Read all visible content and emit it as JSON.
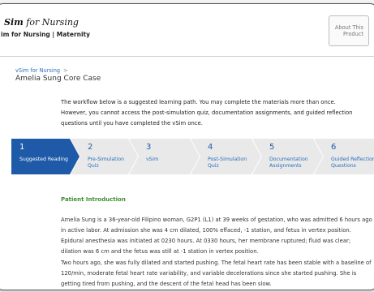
{
  "header": {
    "brand_bold": "Sim",
    "brand_rest": " for Nursing",
    "subtitle": "im for Nursing | Maternity",
    "about_label": "About This Product"
  },
  "breadcrumb": {
    "link": "vSim for Nursing",
    "separator": ">",
    "case_title": "Amelia Sung Core Case"
  },
  "intro": {
    "line1": "The workflow below is a suggested learning path. You may complete the materials more than once.",
    "line2": "However, you cannot access the post-simulation quiz, documentation assignments, and guided reflection",
    "line3": "questions until you have completed the vSim once."
  },
  "steps": [
    {
      "num": "1",
      "label": "Suggested Reading"
    },
    {
      "num": "2",
      "label": "Pre-Simulation Quiz"
    },
    {
      "num": "3",
      "label": "vSim"
    },
    {
      "num": "4",
      "label": "Post-Simulation Quiz"
    },
    {
      "num": "5",
      "label": "Documentation Assignments"
    },
    {
      "num": "6",
      "label": "Guided Reflection Questions"
    }
  ],
  "content": {
    "section_heading": "Patient Introduction",
    "paragraph1": "Amelia Sung is a 36-year-old Filipino woman, G2P1 (L1) at 39 weeks of gestation, who was admitted 6 hours ago in active labor. At admission she was 4 cm dilated, 100% effaced, -1 station, and fetus in vertex position. Epidural anesthesia was initiated at 0230 hours. At 0330 hours, her membrane ruptured; fluid was clear; dilation was 6 cm and the fetus was still at -1 station in vertex position.",
    "paragraph2": "Two hours ago, she was fully dilated and started pushing. The fetal heart rate has been stable with a baseline of 120/min, moderate fetal heart rate variability, and variable decelerations since she started pushing. She is getting tired from pushing, and the descent of the fetal head has been slow."
  },
  "colors": {
    "accent": "#1e5aa8",
    "link": "#2a6ebb",
    "section_heading": "#3e8e2f",
    "step_inactive": "#e9e9e9"
  }
}
